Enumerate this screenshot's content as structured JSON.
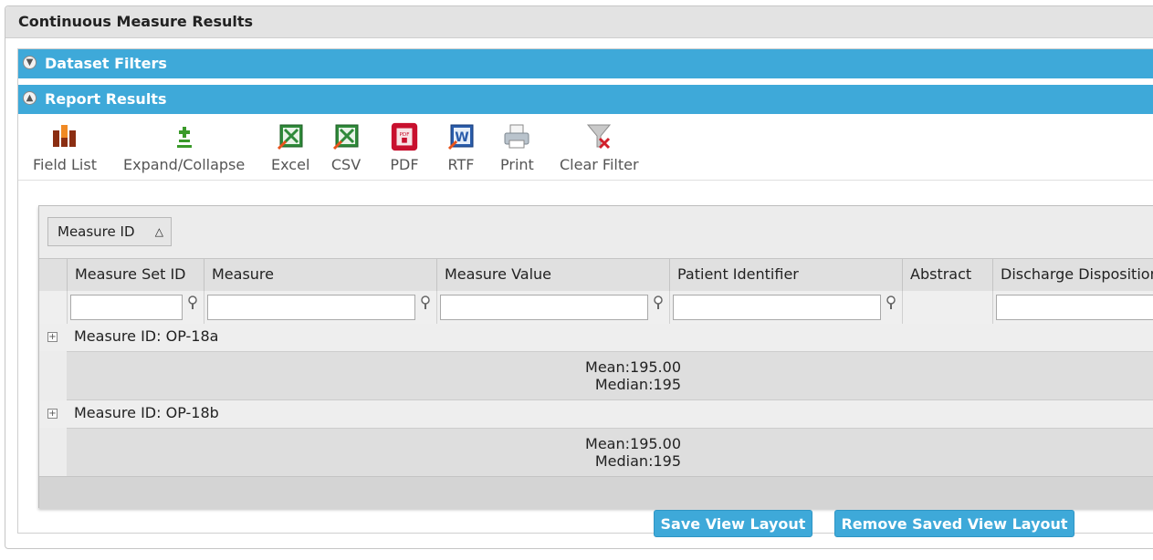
{
  "panel": {
    "title": "Continuous Measure Results"
  },
  "sections": [
    {
      "label": "Dataset Filters",
      "state": "collapsed"
    },
    {
      "label": "Report Results",
      "state": "expanded"
    }
  ],
  "toolbar": {
    "items": [
      {
        "label": "Field List",
        "icon": "field-list-icon"
      },
      {
        "label": "Expand/Collapse",
        "icon": "expand-collapse-icon"
      },
      {
        "label": "Excel",
        "icon": "excel-icon"
      },
      {
        "label": "CSV",
        "icon": "csv-icon"
      },
      {
        "label": "PDF",
        "icon": "pdf-icon"
      },
      {
        "label": "RTF",
        "icon": "rtf-icon"
      },
      {
        "label": "Print",
        "icon": "print-icon"
      },
      {
        "label": "Clear Filter",
        "icon": "clear-filter-icon"
      }
    ]
  },
  "grid": {
    "group_by": {
      "label": "Measure ID",
      "sort": "ascending"
    },
    "columns": [
      "Measure Set ID",
      "Measure",
      "Measure Value",
      "Patient Identifier",
      "Abstract",
      "Discharge Disposition"
    ],
    "filters": {
      "measure_set_id": "",
      "measure": "",
      "measure_value": "",
      "patient_identifier": "",
      "discharge_disposition": ""
    },
    "groups": [
      {
        "label": "Measure ID: OP-18a",
        "mean": "Mean:195.00",
        "median": "Median:195"
      },
      {
        "label": "Measure ID: OP-18b",
        "mean": "Mean:195.00",
        "median": "Median:195"
      }
    ]
  },
  "buttons": {
    "save": "Save View Layout",
    "remove": "Remove Saved View Layout"
  },
  "colors": {
    "section_bar": "#3ea9d9",
    "header_bg": "#e3e3e3"
  }
}
